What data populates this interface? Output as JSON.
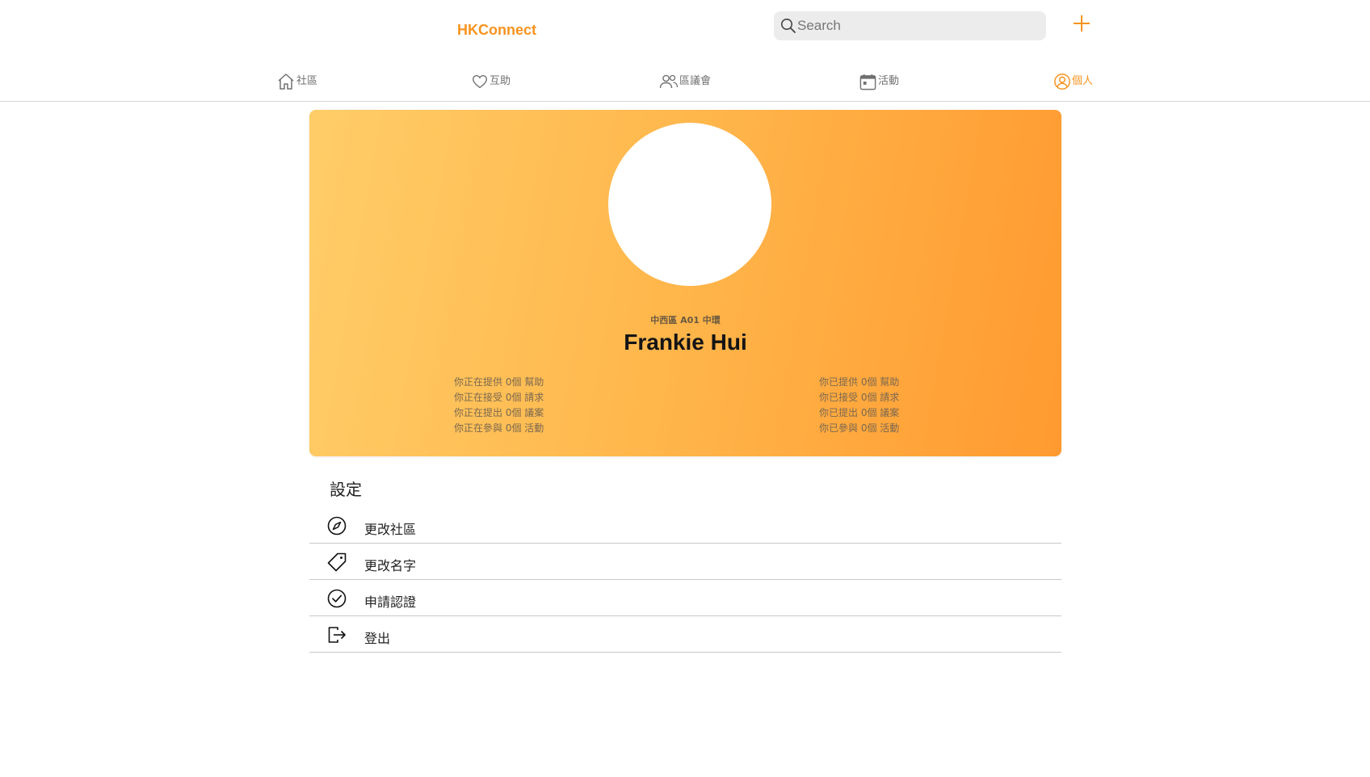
{
  "header": {
    "brand": "HKConnect",
    "search_placeholder": "Search",
    "add_icon": "plus-icon",
    "accent_color": "#f7931e"
  },
  "nav": [
    {
      "label": "社區",
      "icon": "home-icon",
      "active": false
    },
    {
      "label": "互助",
      "icon": "heart-icon",
      "active": false
    },
    {
      "label": "區議會",
      "icon": "people-icon",
      "active": false
    },
    {
      "label": "活動",
      "icon": "calendar-icon",
      "active": false
    },
    {
      "label": "個人",
      "icon": "user-circle-icon",
      "active": true
    }
  ],
  "profile": {
    "district": "中西區 A01 中環",
    "name": "Frankie Hui",
    "current_stats": [
      "你正在提供 0個 幫助",
      "你正在接受 0個 請求",
      "你正在提出 0個 議案",
      "你正在參與 0個 活動"
    ],
    "past_stats": [
      "你已提供 0個 幫助",
      "你已接受 0個 請求",
      "你已提出 0個 議案",
      "你已參與 0個 活動"
    ]
  },
  "settings": {
    "title": "設定",
    "items": [
      {
        "label": "更改社區",
        "icon": "compass-icon"
      },
      {
        "label": "更改名字",
        "icon": "tag-icon"
      },
      {
        "label": "申請認證",
        "icon": "check-circle-icon"
      },
      {
        "label": "登出",
        "icon": "logout-icon"
      }
    ]
  }
}
